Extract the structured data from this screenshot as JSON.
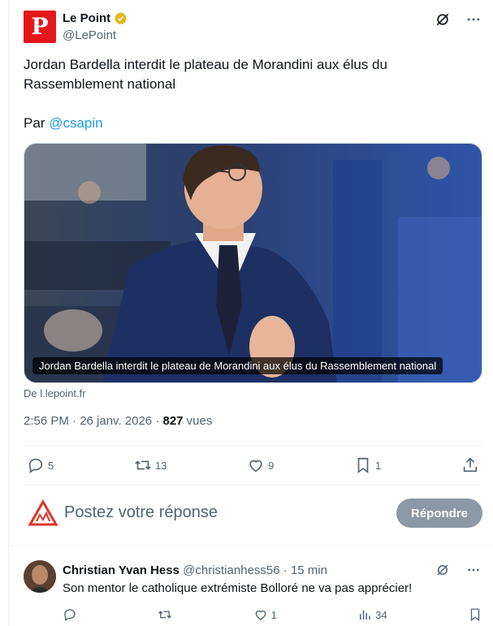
{
  "author": {
    "logo_letter": "P",
    "name": "Le Point",
    "handle": "@LePoint",
    "brand_color": "#e4171b",
    "verified_color": "#e2b719"
  },
  "tweet": {
    "text_line1": "Jordan Bardella interdit le plateau de Morandini aux élus du Rassemblement national",
    "text_prefix": "Par ",
    "mention": "@csapin",
    "media_caption": "Jordan Bardella interdit le plateau de Morandini aux élus du Rassemblement national",
    "source": "De l.lepoint.fr",
    "timestamp": "2:56 PM · 26 janv. 2026 · ",
    "views_count": "827",
    "views_label": " vues"
  },
  "actions": {
    "replies": "5",
    "retweets": "13",
    "likes": "9",
    "bookmarks": "1"
  },
  "composer": {
    "placeholder": "Postez votre réponse",
    "button_label": "Répondre",
    "button_color": "#8b98a5"
  },
  "reply": {
    "name": "Christian Yvan Hess",
    "handle": "@christianhess56",
    "separator": " · ",
    "time": "15 min",
    "text": "Son mentor le catholique extrémiste Bolloré ne va pas apprécier!",
    "actions": {
      "likes": "1",
      "views": "34"
    }
  },
  "colors": {
    "text": "#0f1419",
    "muted": "#536471",
    "link": "#1d9bf0"
  }
}
